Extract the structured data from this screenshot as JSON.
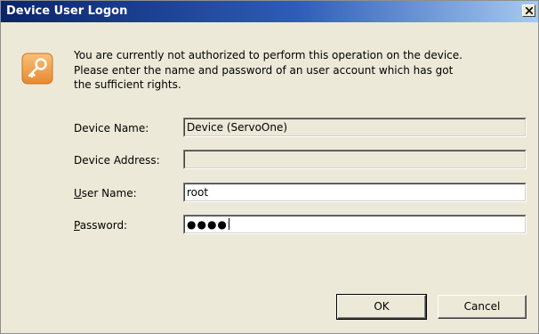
{
  "window": {
    "title": "Device User Logon"
  },
  "icons": {
    "dialog": "key-icon",
    "close": "close-icon"
  },
  "message": {
    "line1": "You are currently not authorized to perform this operation on the device.",
    "line2": "Please enter the name and password of an user account which has got",
    "line3": "the sufficient rights."
  },
  "form": {
    "device_name": {
      "label": "Device Name:",
      "value": "Device (ServoOne)"
    },
    "device_address": {
      "label": "Device Address:",
      "value": ""
    },
    "user_name": {
      "label_mnemonic": "U",
      "label_rest": "ser Name:",
      "value": "root"
    },
    "password": {
      "label_mnemonic": "P",
      "label_rest": "assword:",
      "value": "●●●●"
    }
  },
  "buttons": {
    "ok": "OK",
    "cancel": "Cancel"
  },
  "colors": {
    "dialog_bg": "#ece9d8",
    "title_bar_start": "#0a246a",
    "title_bar_end": "#a6caf0",
    "icon_orange": "#f5a24a"
  }
}
